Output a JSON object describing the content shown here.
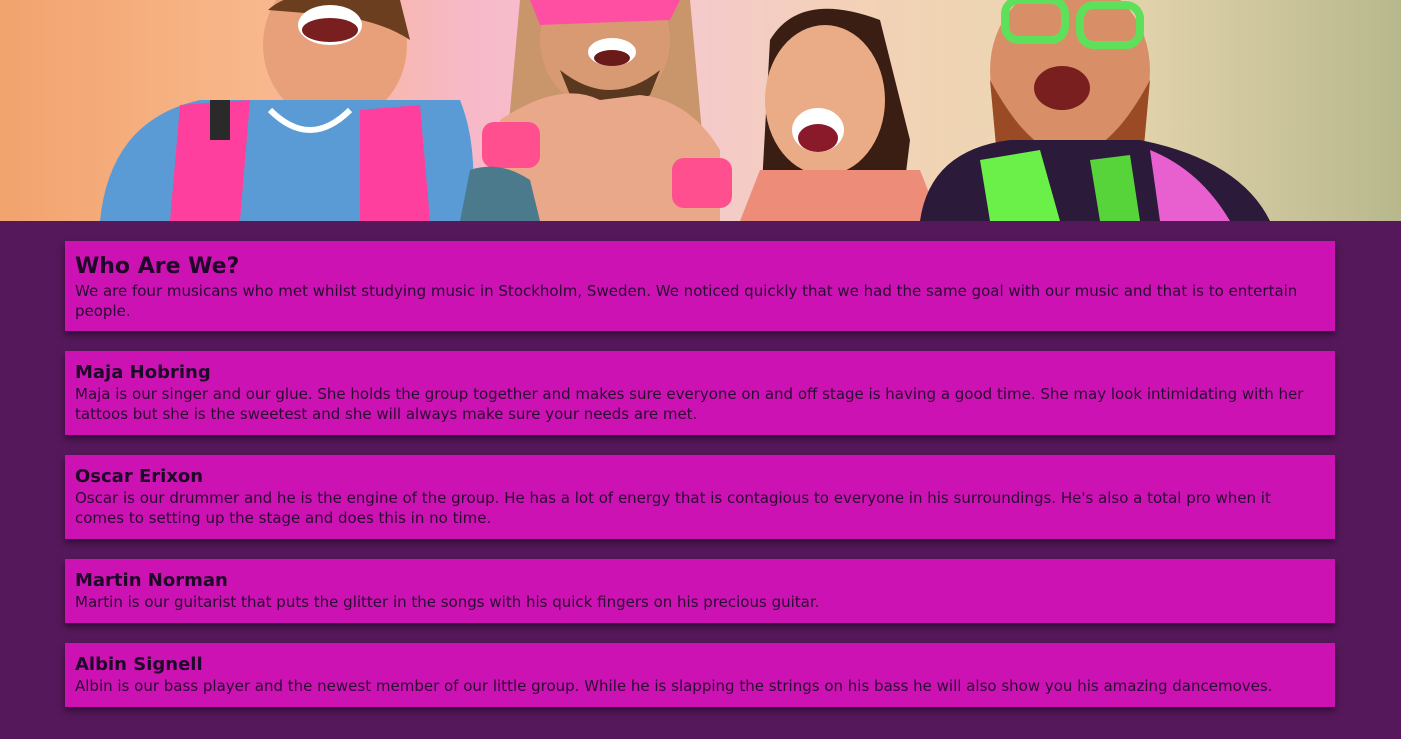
{
  "hero": {
    "image_alt": "Four band members laughing in colorful neon clothing",
    "image_icon": "band-photo"
  },
  "intro": {
    "title": "Who Are We?",
    "text": "We are four musicans who met whilst studying music in Stockholm, Sweden. We noticed quickly that we had the same goal with our music and that is to entertain people."
  },
  "members": [
    {
      "name": "Maja Hobring",
      "bio": "Maja is our singer and our glue. She holds the group together and makes sure everyone on and off stage is having a good time. She may look intimidating with her tattoos but she is the sweetest and she will always make sure your needs are met."
    },
    {
      "name": "Oscar Erixon",
      "bio": "Oscar is our drummer and he is the engine of the group. He has a lot of energy that is contagious to everyone in his surroundings. He's also a total pro when it comes to setting up the stage and does this in no time."
    },
    {
      "name": "Martin Norman",
      "bio": "Martin is our guitarist that puts the glitter in the songs with his quick fingers on his precious guitar."
    },
    {
      "name": "Albin Signell",
      "bio": "Albin is our bass player and the newest member of our little group. While he is slapping the strings on his bass he will also show you his amazing dancemoves."
    }
  ],
  "colors": {
    "page_background": "#55185a",
    "card_background": "#cc12b2",
    "text": "#1e0828"
  }
}
